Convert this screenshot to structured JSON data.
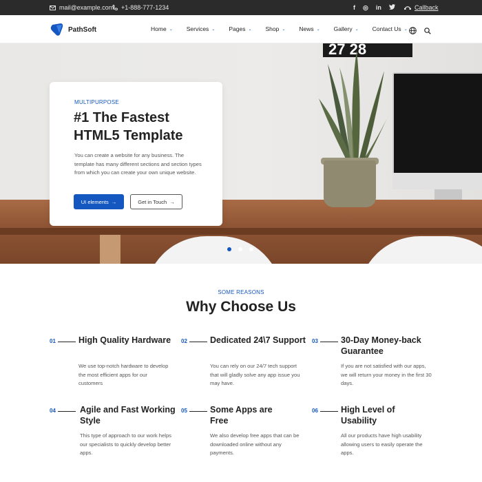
{
  "topbar": {
    "email": "mail@example.com",
    "phone": "+1-888-777-1234",
    "social": [
      "f",
      "◎",
      "in",
      "t"
    ],
    "callback": "Callback"
  },
  "header": {
    "brand": "PathSoft",
    "nav": [
      {
        "label": "Home"
      },
      {
        "label": "Services"
      },
      {
        "label": "Pages"
      },
      {
        "label": "Shop"
      },
      {
        "label": "News"
      },
      {
        "label": "Gallery"
      },
      {
        "label": "Contact Us"
      }
    ]
  },
  "hero": {
    "calendar": "27 28",
    "kicker": "MULTIPURPOSE",
    "title": "#1 The Fastest HTML5 Template",
    "description": "You can create a website for any business. The template has many different sections and section types from which you can create your own unique website.",
    "primary_button": "UI elements",
    "secondary_button": "Get in Touch",
    "slides_active": 0
  },
  "section": {
    "kicker": "SOME REASONS",
    "title": "Why Choose Us",
    "features": [
      {
        "num": "01",
        "title": "High Quality Hardware",
        "desc": "We use top-notch hardware to develop the most efficient apps for our customers"
      },
      {
        "num": "02",
        "title": "Dedicated 24\\7 Support",
        "desc": "You can rely on our 24/7 tech support that will gladly solve any app issue you may have."
      },
      {
        "num": "03",
        "title": "30-Day Money-back Guarantee",
        "desc": "If you are not satisfied with our apps, we will return your money in the first 30 days."
      },
      {
        "num": "04",
        "title": "Agile and Fast Working Style",
        "desc": "This type of approach to our work helps our specialists to quickly develop better apps."
      },
      {
        "num": "05",
        "title": "Some Apps are Free",
        "desc": "We also develop free apps that can be downloaded online without any payments."
      },
      {
        "num": "06",
        "title": "High Level of Usability",
        "desc": "All our products have high usability allowing users to easily operate the apps."
      }
    ]
  },
  "colors": {
    "accent": "#1557c0",
    "topbar": "#2b2b2b"
  }
}
